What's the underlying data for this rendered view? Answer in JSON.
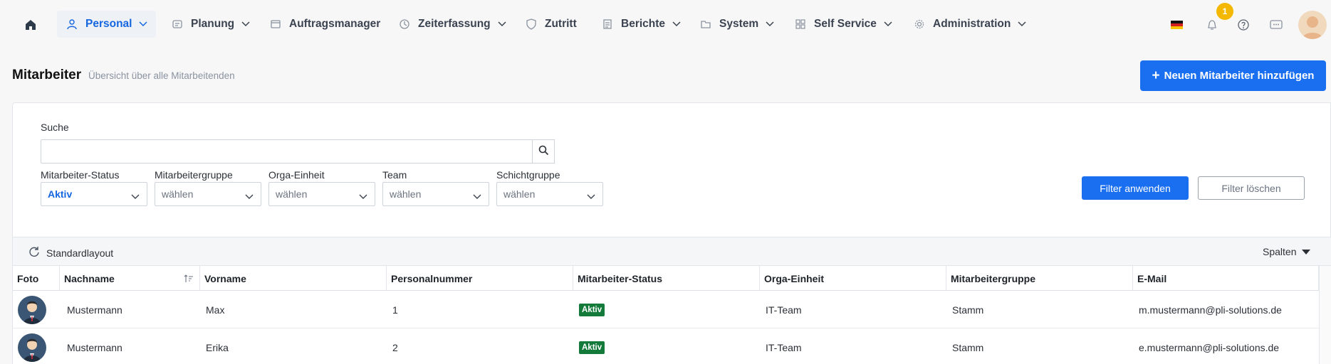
{
  "nav": {
    "items": [
      {
        "label": "Personal",
        "icon": "users-icon",
        "active": true,
        "dropdown": true
      },
      {
        "label": "Planung",
        "icon": "planning-icon",
        "dropdown": true
      },
      {
        "label": "Auftragsmanager",
        "icon": "window-icon",
        "dropdown": false
      },
      {
        "label": "Zeiterfassung",
        "icon": "clock-icon",
        "dropdown": true
      },
      {
        "label": "Zutritt",
        "icon": "shield-icon",
        "dropdown": false
      },
      {
        "label": "Berichte",
        "icon": "report-icon",
        "dropdown": true
      },
      {
        "label": "System",
        "icon": "folder-icon",
        "dropdown": true
      },
      {
        "label": "Self Service",
        "icon": "grid-icon",
        "dropdown": true
      },
      {
        "label": "Administration",
        "icon": "gear-icon",
        "dropdown": true
      }
    ],
    "notification_count": "1",
    "accent": "#1566e0"
  },
  "page": {
    "title": "Mitarbeiter",
    "subtitle": "Übersicht über alle Mitarbeitenden",
    "add_button": "Neuen Mitarbeiter hinzufügen"
  },
  "filters": {
    "search_label": "Suche",
    "search_value": "",
    "fields": [
      {
        "label": "Mitarbeiter-Status",
        "value": "Aktiv"
      },
      {
        "label": "Mitarbeitergruppe",
        "value": "wählen"
      },
      {
        "label": "Orga-Einheit",
        "value": "wählen"
      },
      {
        "label": "Team",
        "value": "wählen"
      },
      {
        "label": "Schichtgruppe",
        "value": "wählen"
      }
    ],
    "apply": "Filter anwenden",
    "clear": "Filter löschen"
  },
  "grid": {
    "layout_label": "Standardlayout",
    "columns_label": "Spalten",
    "headers": [
      "Foto",
      "Nachname",
      "Vorname",
      "Personalnummer",
      "Mitarbeiter-Status",
      "Orga-Einheit",
      "Mitarbeitergruppe",
      "E-Mail"
    ],
    "rows": [
      {
        "nachname": "Mustermann",
        "vorname": "Max",
        "personalnummer": "1",
        "status": "Aktiv",
        "orga": "IT-Team",
        "gruppe": "Stamm",
        "email": "m.mustermann@pli-solutions.de"
      },
      {
        "nachname": "Mustermann",
        "vorname": "Erika",
        "personalnummer": "2",
        "status": "Aktiv",
        "orga": "IT-Team",
        "gruppe": "Stamm",
        "email": "e.mustermann@pli-solutions.de"
      }
    ]
  }
}
